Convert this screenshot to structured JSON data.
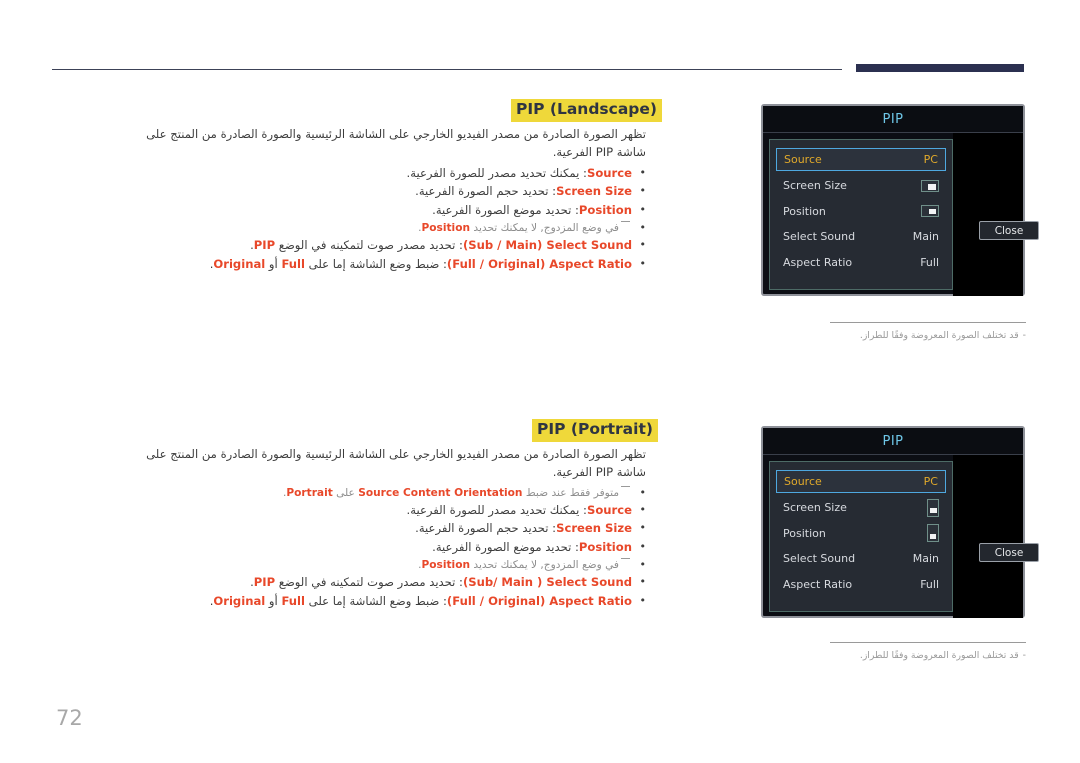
{
  "page": {
    "number": "72",
    "note_marker": "-"
  },
  "sections": [
    {
      "id": "landscape",
      "title": "PIP (Landscape)",
      "lead": "تظهر الصورة الصادرة من مصدر الفيديو الخارجي على الشاشة الرئيسية والصورة الصادرة من المنتج على شاشة PIP الفرعية.",
      "bullets": [
        {
          "kw": "Source",
          "text": ": يمكنك تحديد مصدر للصورة الفرعية."
        },
        {
          "kw": "Screen Size",
          "text": ": تحديد حجم الصورة الفرعية."
        },
        {
          "kw": "Position",
          "text": ": تحديد موضع الصورة الفرعية."
        },
        {
          "kw": "(Sub / Main) Select Sound",
          "text": ": تحديد مصدر صوت لتمكينه في الوضع ",
          "kw_tail": "PIP",
          "tail": "."
        },
        {
          "kw": "(Full / Original) Aspect Ratio",
          "text": ": ضبط وضع الشاشة إما على ",
          "kw_mid": "Full",
          "mid": " أو ",
          "kw_tail": "Original",
          "tail": "."
        }
      ],
      "subnote": {
        "pre": "في وضع المزدوج, لا يمكنك تحديد ",
        "kw": "Position",
        "post": "."
      },
      "subnote_index": 3
    },
    {
      "id": "portrait",
      "title": "PIP (Portrait)",
      "lead": "تظهر الصورة الصادرة من مصدر الفيديو الخارجي على الشاشة الرئيسية والصورة الصادرة من المنتج على شاشة PIP الفرعية.",
      "top_subnote": {
        "pre": "متوفر فقط عند ضبط ",
        "kw": "Source Content Orientation",
        "mid": " على ",
        "kw_tail": "Portrait",
        "post": "."
      },
      "bullets": [
        {
          "kw": "Source",
          "text": ": يمكنك تحديد مصدر للصورة الفرعية."
        },
        {
          "kw": "Screen Size",
          "text": ": تحديد حجم الصورة الفرعية."
        },
        {
          "kw": "Position",
          "text": ": تحديد موضع الصورة الفرعية."
        },
        {
          "kw": "(Sub/ Main ) Select Sound",
          "text": ": تحديد مصدر صوت لتمكينه في الوضع ",
          "kw_tail": "PIP",
          "tail": "."
        },
        {
          "kw": "(Full / Original) Aspect Ratio",
          "text": ": ضبط وضع الشاشة إما على ",
          "kw_mid": "Full",
          "mid": " أو ",
          "kw_tail": "Original",
          "tail": "."
        }
      ],
      "subnote": {
        "pre": "في وضع المزدوج, لا يمكنك تحديد ",
        "kw": "Position",
        "post": "."
      },
      "subnote_index": 3
    }
  ],
  "osd": {
    "title": "PIP",
    "close_label": "Close",
    "rows": [
      {
        "label": "Source",
        "value": "PC",
        "type": "text",
        "selected": true
      },
      {
        "label": "Screen Size",
        "value": "",
        "type": "icon-size",
        "selected": false
      },
      {
        "label": "Position",
        "value": "",
        "type": "icon-pos",
        "selected": false
      },
      {
        "label": "Select Sound",
        "value": "Main",
        "type": "text",
        "selected": false
      },
      {
        "label": "Aspect Ratio",
        "value": "Full",
        "type": "text",
        "selected": false
      }
    ]
  },
  "figure_note": "قد تختلف الصورة المعروضة وفقًا للطراز.",
  "colors": {
    "highlight": "#efd83a",
    "keyword": "#e8482a",
    "osd_title": "#6fc7e8",
    "osd_selected_text": "#e0a92b",
    "osd_selected_border": "#4ea8e0",
    "header_bar": "#2b3050",
    "page_number": "#a8a8a8"
  }
}
